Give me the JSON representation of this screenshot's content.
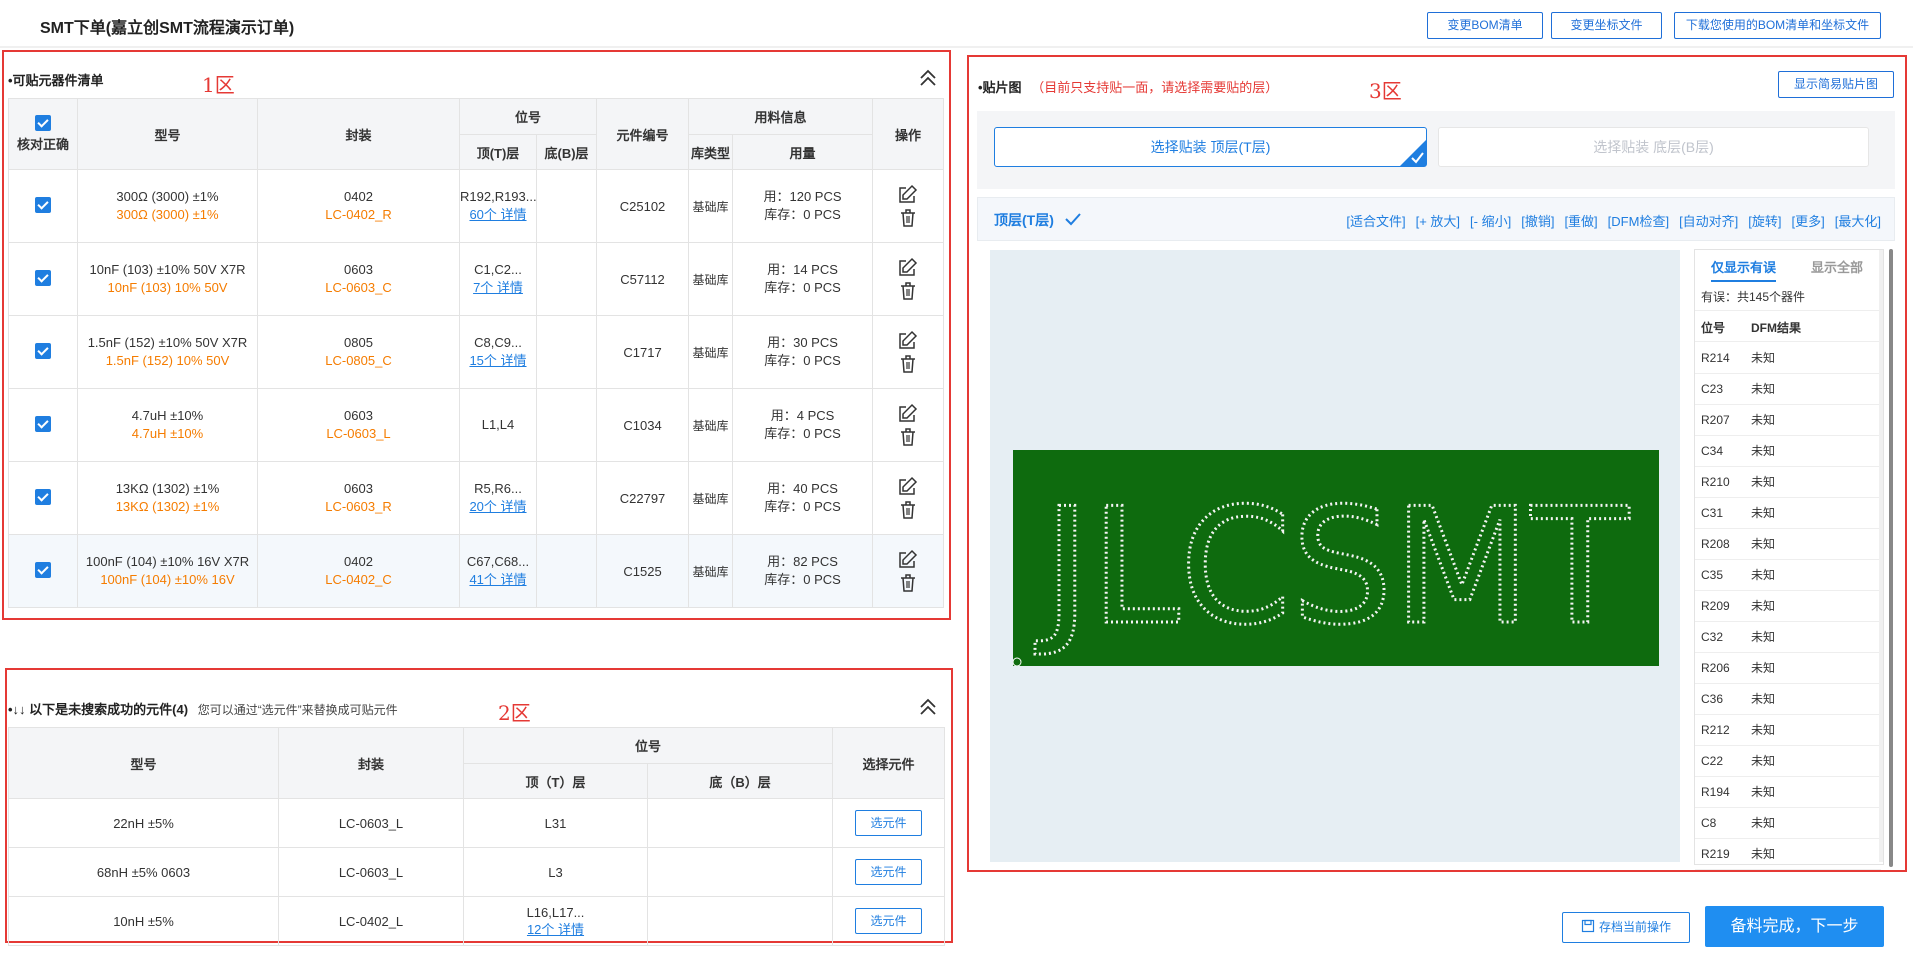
{
  "header": {
    "title": "SMT下单(嘉立创SMT流程演示订单)",
    "btn_change_bom": "变更BOM清单",
    "btn_change_coords": "变更坐标文件",
    "btn_download": "下载您使用的BOM清单和坐标文件"
  },
  "zone_labels": {
    "z1": "1区",
    "z2": "2区",
    "z3": "3区"
  },
  "placeable": {
    "title": "•可贴元器件清单",
    "headers": {
      "verify": "核对正确",
      "model": "型号",
      "package": "封装",
      "designator": "位号",
      "top": "顶(T)层",
      "bottom": "底(B)层",
      "part_no": "元件编号",
      "material": "用料信息",
      "lib_type": "库类型",
      "qty": "用量",
      "ops": "操作"
    },
    "rows": [
      {
        "model": "300Ω (3000) ±1%",
        "model2": "300Ω (3000) ±1%",
        "pkg": "0402",
        "pkg2": "LC-0402_R",
        "top": "R192,R193...",
        "detail": "60个 详情",
        "part": "C25102",
        "lib": "基础库",
        "used": "用：120 PCS",
        "stock": "库存：0 PCS"
      },
      {
        "model": "10nF (103) ±10% 50V X7R",
        "model2": "10nF (103) 10% 50V",
        "pkg": "0603",
        "pkg2": "LC-0603_C",
        "top": "C1,C2...",
        "detail": "7个 详情",
        "part": "C57112",
        "lib": "基础库",
        "used": "用：14 PCS",
        "stock": "库存：0 PCS"
      },
      {
        "model": "1.5nF (152) ±10% 50V X7R",
        "model2": "1.5nF (152) 10% 50V",
        "pkg": "0805",
        "pkg2": "LC-0805_C",
        "top": "C8,C9...",
        "detail": "15个 详情",
        "part": "C1717",
        "lib": "基础库",
        "used": "用：30 PCS",
        "stock": "库存：0 PCS"
      },
      {
        "model": "4.7uH ±10%",
        "model2": "4.7uH ±10%",
        "pkg": "0603",
        "pkg2": "LC-0603_L",
        "top": "L1,L4",
        "detail": "",
        "part": "C1034",
        "lib": "基础库",
        "used": "用：4 PCS",
        "stock": "库存：0 PCS"
      },
      {
        "model": "13KΩ (1302) ±1%",
        "model2": "13KΩ (1302) ±1%",
        "pkg": "0603",
        "pkg2": "LC-0603_R",
        "top": "R5,R6...",
        "detail": "20个 详情",
        "part": "C22797",
        "lib": "基础库",
        "used": "用：40 PCS",
        "stock": "库存：0 PCS"
      },
      {
        "model": "100nF (104) ±10% 16V X7R",
        "model2": "100nF (104) ±10% 16V",
        "pkg": "0402",
        "pkg2": "LC-0402_C",
        "top": "C67,C68...",
        "detail": "41个 详情",
        "part": "C1525",
        "lib": "基础库",
        "used": "用：82 PCS",
        "stock": "库存：0 PCS"
      }
    ]
  },
  "unmatched": {
    "title": "•↓↓ 以下是未搜索成功的元件(4)",
    "hint": "您可以通过“选元件”来替换成可贴元件",
    "headers": {
      "model": "型号",
      "package": "封装",
      "designator": "位号",
      "top": "顶（T）层",
      "bottom": "底（B）层",
      "select": "选择元件"
    },
    "pick_label": "选元件",
    "rows": [
      {
        "model": "22nH ±5%",
        "pkg": "LC-0603_L",
        "top": "L31",
        "detail": ""
      },
      {
        "model": "68nH ±5% 0603",
        "pkg": "LC-0603_L",
        "top": "L3",
        "detail": ""
      },
      {
        "model": "10nH ±5%",
        "pkg": "LC-0402_L",
        "top": "L16,L17...",
        "detail": "12个 详情"
      }
    ]
  },
  "placement": {
    "title": "•贴片图",
    "note": "（目前只支持贴一面，请选择需要贴的层）",
    "simple_btn": "显示简易贴片图",
    "top_layer_btn": "选择贴装 顶层(T层)",
    "bottom_layer_btn": "选择贴装 底层(B层)",
    "layer_label": "顶层(T层)",
    "tools": [
      "[适合文件]",
      "[+ 放大]",
      "[- 缩小]",
      "[撤销]",
      "[重做]",
      "[DFM检查]",
      "[自动对齐]",
      "[旋转]",
      "[更多]",
      "[最大化]"
    ],
    "board_text": "JLCSMT",
    "dfm": {
      "tab_errors": "仅显示有误",
      "tab_all": "显示全部",
      "count": "有误：共145个器件",
      "col_des": "位号",
      "col_result": "DFM结果",
      "rows": [
        {
          "des": "R214",
          "res": "未知"
        },
        {
          "des": "C23",
          "res": "未知"
        },
        {
          "des": "R207",
          "res": "未知"
        },
        {
          "des": "C34",
          "res": "未知"
        },
        {
          "des": "R210",
          "res": "未知"
        },
        {
          "des": "C31",
          "res": "未知"
        },
        {
          "des": "R208",
          "res": "未知"
        },
        {
          "des": "C35",
          "res": "未知"
        },
        {
          "des": "R209",
          "res": "未知"
        },
        {
          "des": "C32",
          "res": "未知"
        },
        {
          "des": "R206",
          "res": "未知"
        },
        {
          "des": "C36",
          "res": "未知"
        },
        {
          "des": "R212",
          "res": "未知"
        },
        {
          "des": "C22",
          "res": "未知"
        },
        {
          "des": "R194",
          "res": "未知"
        },
        {
          "des": "C8",
          "res": "未知"
        },
        {
          "des": "R219",
          "res": "未知"
        }
      ]
    }
  },
  "footer": {
    "save_btn": "存档当前操作",
    "next_btn": "备料完成，下一步"
  },
  "colors": {
    "accent": "#1f7ee0",
    "zone_border": "#e53935",
    "pcb_green": "#0e6b0e",
    "orange": "#f57c00"
  }
}
